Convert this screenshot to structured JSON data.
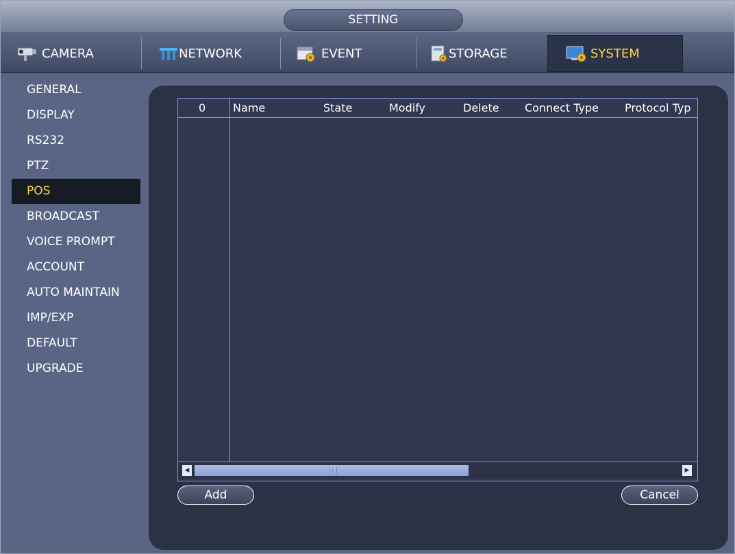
{
  "window": {
    "title": "SETTING"
  },
  "tabs": [
    {
      "label": "CAMERA",
      "icon": "camera-icon"
    },
    {
      "label": "NETWORK",
      "icon": "network-icon"
    },
    {
      "label": "EVENT",
      "icon": "event-icon"
    },
    {
      "label": "STORAGE",
      "icon": "storage-icon"
    },
    {
      "label": "SYSTEM",
      "icon": "system-icon",
      "active": true
    }
  ],
  "sidebar": {
    "items": [
      {
        "label": "GENERAL"
      },
      {
        "label": "DISPLAY"
      },
      {
        "label": "RS232"
      },
      {
        "label": "PTZ"
      },
      {
        "label": "POS",
        "active": true
      },
      {
        "label": "BROADCAST"
      },
      {
        "label": "VOICE PROMPT"
      },
      {
        "label": "ACCOUNT"
      },
      {
        "label": "AUTO MAINTAIN"
      },
      {
        "label": "IMP/EXP"
      },
      {
        "label": "DEFAULT"
      },
      {
        "label": "UPGRADE"
      }
    ]
  },
  "table": {
    "columns": [
      "0",
      "Name",
      "State",
      "Modify",
      "Delete",
      "Connect Type",
      "Protocol Typ"
    ],
    "rows": []
  },
  "buttons": {
    "add": "Add",
    "cancel": "Cancel"
  },
  "colors": {
    "active_text": "#ffd44a",
    "grid_line": "#8898e6",
    "panel_bg": "#2b3246"
  }
}
